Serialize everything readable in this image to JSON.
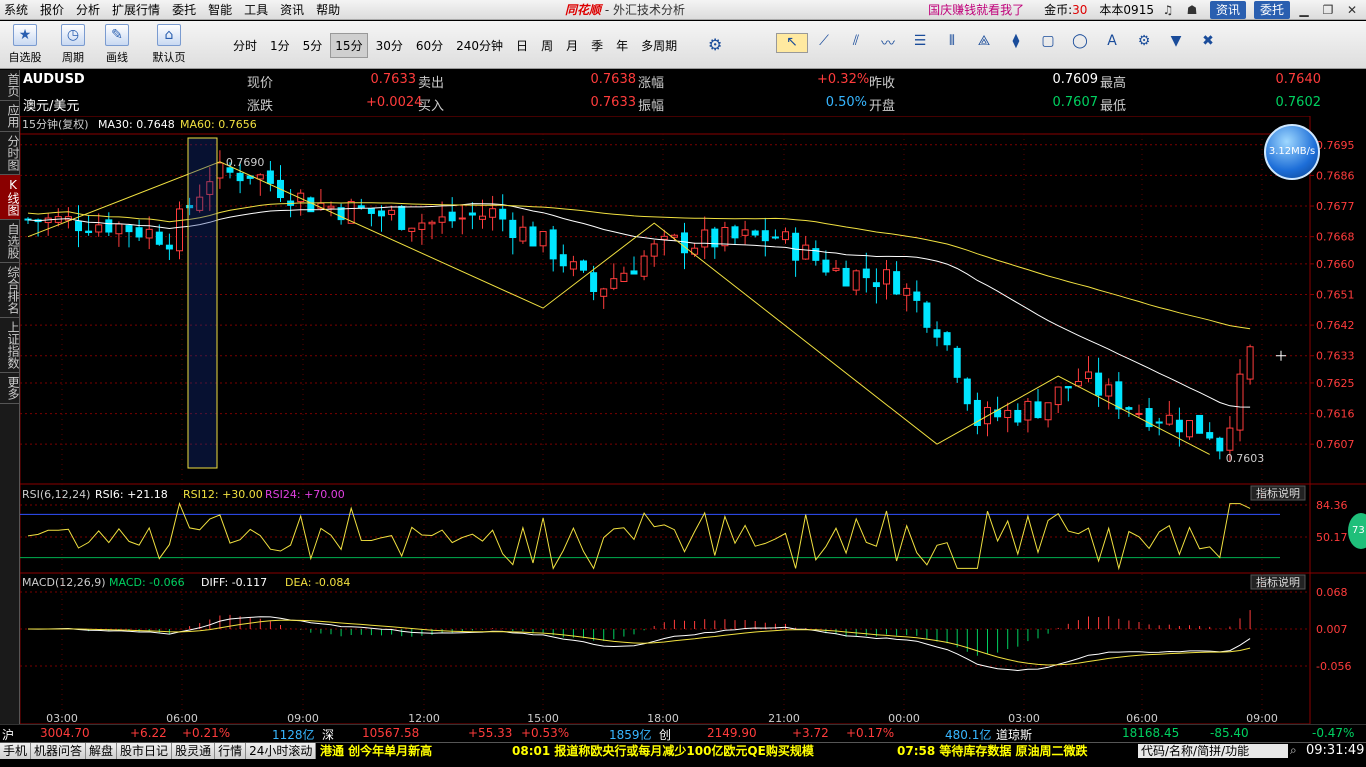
{
  "menu": {
    "items": [
      "系统",
      "报价",
      "分析",
      "扩展行情",
      "委托",
      "智能",
      "工具",
      "资讯",
      "帮助"
    ],
    "app_logo": "同花顺",
    "app_title": " - 外汇技术分析",
    "promo": "国庆赚钱就看我了",
    "coins_label": "金币:",
    "coins_value": "30",
    "version": "本本0915",
    "btn_news": "资讯",
    "btn_trade": "委托"
  },
  "toolbar": {
    "left_buttons": [
      {
        "label": "自选股",
        "icon": "star-icon",
        "glyph": "★"
      },
      {
        "label": "周期",
        "icon": "clock-icon",
        "glyph": "◷"
      },
      {
        "label": "画线",
        "icon": "pencil-icon",
        "glyph": "✎"
      },
      {
        "label": "默认页",
        "icon": "home-icon",
        "glyph": "⌂"
      }
    ],
    "periods": [
      "分时",
      "1分",
      "5分",
      "15分",
      "30分",
      "60分",
      "240分钟",
      "日",
      "周",
      "月",
      "季",
      "年",
      "多周期"
    ],
    "selected_period": "15分",
    "draw_tools": [
      {
        "icon": "cursor-icon",
        "glyph": "↖"
      },
      {
        "icon": "line-tool-icon",
        "glyph": "⟋"
      },
      {
        "icon": "parallel-lines-icon",
        "glyph": "⫽"
      },
      {
        "icon": "wave-tool-icon",
        "glyph": "〰"
      },
      {
        "icon": "fibonacci-icon",
        "glyph": "☰"
      },
      {
        "icon": "vertical-lines-icon",
        "glyph": "⦀"
      },
      {
        "icon": "fan-icon",
        "glyph": "⟁"
      },
      {
        "icon": "channel-icon",
        "glyph": "⧫"
      },
      {
        "icon": "rectangle-tool-icon",
        "glyph": "▢"
      },
      {
        "icon": "ellipse-tool-icon",
        "glyph": "◯"
      },
      {
        "icon": "text-tool-icon",
        "glyph": "A"
      },
      {
        "icon": "settings-icon",
        "glyph": "⚙"
      },
      {
        "icon": "bookmark-icon",
        "glyph": "▼"
      },
      {
        "icon": "delete-icon",
        "glyph": "✖"
      }
    ]
  },
  "sidebar": [
    "首页",
    "应用",
    "分时图",
    "K线图",
    "自选股",
    "综合排名",
    "上证指数",
    "更多"
  ],
  "sidebar_selected": "K线图",
  "quote": {
    "symbol": "AUDUSD",
    "name": "澳元/美元",
    "row1": [
      {
        "label": "现价",
        "value": "0.7633",
        "color": "red"
      },
      {
        "label": "卖出",
        "value": "0.7638",
        "color": "red"
      },
      {
        "label": "涨幅",
        "value": "+0.32%",
        "color": "red"
      },
      {
        "label": "昨收",
        "value": "0.7609",
        "color": "wht"
      },
      {
        "label": "最高",
        "value": "0.7640",
        "color": "red"
      }
    ],
    "row2": [
      {
        "label": "涨跌",
        "value": "+0.0024",
        "color": "red"
      },
      {
        "label": "买入",
        "value": "0.7633",
        "color": "red"
      },
      {
        "label": "振幅",
        "value": "0.50%",
        "color": "cyan"
      },
      {
        "label": "开盘",
        "value": "0.7607",
        "color": "grn"
      },
      {
        "label": "最低",
        "value": "0.7602",
        "color": "grn"
      }
    ]
  },
  "main_header": {
    "period": "15分钟(复权)",
    "ma30": "MA30: 0.7648",
    "ma60": "MA60: 0.7656"
  },
  "rsi_header": {
    "name": "RSI(6,12,24)",
    "rsi6": "RSI6: +21.18",
    "rsi12": "RSI12: +30.00",
    "rsi24": "RSI24: +70.00"
  },
  "macd_header": {
    "name": "MACD(12,26,9)",
    "macd": "MACD: -0.066",
    "diff": "DIFF: -0.117",
    "dea": "DEA: -0.084"
  },
  "indicator_help": "指标说明",
  "speed_badge": "3.12MB/s",
  "badge_73": "73",
  "chart_data": {
    "type": "candlestick",
    "y_ticks": [
      "0.7695",
      "0.7686",
      "0.7677",
      "0.7668",
      "0.7660",
      "0.7651",
      "0.7642",
      "0.7633",
      "0.7625",
      "0.7616",
      "0.7607"
    ],
    "ylim": [
      0.76,
      0.7697
    ],
    "x_ticks": [
      "03:00",
      "06:00",
      "09:00",
      "12:00",
      "15:00",
      "18:00",
      "21:00",
      "00:00",
      "03:00",
      "06:00",
      "09:00"
    ],
    "annotation_high": "0.7690",
    "annotation_low": "0.7603",
    "rsi_ticks": [
      "84.36",
      "50.17"
    ],
    "macd_ticks": [
      "0.068",
      "0.007",
      "-0.056"
    ],
    "ma30_color": "#ffffff",
    "ma60_color": "#f0e040",
    "up_color": "#ff3c3c",
    "down_color": "#00e5ff"
  },
  "status": {
    "sh_label": "沪",
    "sh_value": "3004.70",
    "sh_chg": "+6.22",
    "sh_pct": "+0.21%",
    "sh_amt": "1128亿",
    "sz_label": "深",
    "sz_value": "10567.58",
    "sz_chg": "+55.33",
    "sz_pct": "+0.53%",
    "sz_amt": "1859亿",
    "cy_label": "创",
    "cy_value": "2149.90",
    "cy_chg": "+3.72",
    "cy_pct": "+0.17%",
    "cy_amt": "480.1亿",
    "dj_label": "道琼斯",
    "dj_value": "18168.45",
    "dj_chg": "-85.40",
    "dj_pct": "-0.47%"
  },
  "bottom": {
    "tabs": [
      "手机",
      "机器问答",
      "解盘",
      "股市日记",
      "股灵通",
      "行情",
      "24小时滚动"
    ],
    "news1": "港通 创今年单月新高",
    "news2": "08:01 报道称欧央行或每月减少100亿欧元QE购买规模",
    "news3": "07:58 等待库存数据 原油周二微跌",
    "search": "代码/名称/简拼/功能",
    "clock": "09:31:49"
  }
}
